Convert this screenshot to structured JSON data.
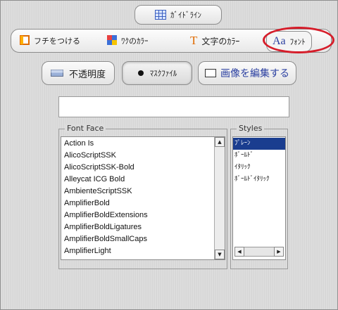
{
  "toolbar": {
    "guide_label": "ｶﾞｲﾄﾞﾗｲﾝ"
  },
  "tabs": [
    {
      "label": "フチをつける"
    },
    {
      "label": "ﾜｸのｶﾗｰ"
    },
    {
      "label": "文字のｶﾗｰ"
    },
    {
      "label": "ﾌｫﾝﾄ",
      "icon_text": "Aa",
      "active": true
    }
  ],
  "actions": {
    "opacity_label": "不透明度",
    "mask_label": "ﾏｽｸﾌｧｲﾙ",
    "edit_label": "画像を編集する"
  },
  "text_input": {
    "value": ""
  },
  "font_face": {
    "title": "Font Face",
    "items": [
      "Action Is",
      "AlicoScriptSSK",
      "AlicoScriptSSK-Bold",
      "Alleycat ICG Bold",
      "AmbienteScriptSSK",
      "AmplifierBold",
      "AmplifierBoldExtensions",
      "AmplifierBoldLigatures",
      "AmplifierBoldSmallCaps",
      "AmplifierLight"
    ]
  },
  "styles": {
    "title": "Styles",
    "items": [
      "ﾌﾟﾚｰﾝ",
      "ﾎﾞｰﾙﾄﾞ",
      "ｲﾀﾘｯｸ",
      "ﾎﾞｰﾙﾄﾞｲﾀﾘｯｸ"
    ],
    "selected_index": 0
  },
  "colors": {
    "highlight_ring": "#d61d2a",
    "selection": "#1a3d8f"
  },
  "icons": [
    "grid-icon",
    "frame-icon",
    "frame-color-icon",
    "text-color-icon",
    "font-icon",
    "opacity-icon",
    "mask-icon",
    "edit-image-icon"
  ]
}
